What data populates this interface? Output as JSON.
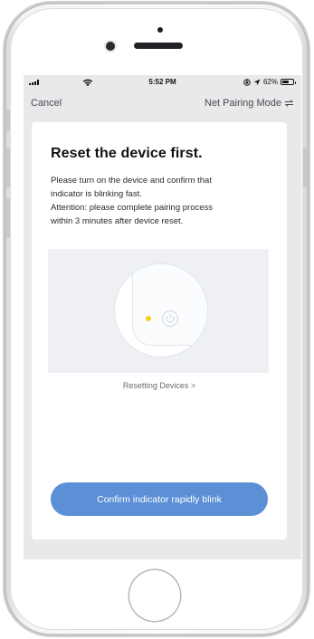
{
  "status_bar": {
    "time": "5:52 PM",
    "battery_percent": "62%",
    "battery_level": 0.62
  },
  "nav": {
    "cancel_label": "Cancel",
    "mode_label": "Net Pairing Mode"
  },
  "card": {
    "title": "Reset the device first.",
    "description_lines": [
      "Please turn on the device and confirm that",
      "indicator is blinking fast.",
      "Attention: please complete pairing process",
      "within 3 minutes after device reset."
    ],
    "reset_link_label": "Resetting Devices >"
  },
  "confirm_button_label": "Confirm indicator rapidly blink",
  "colors": {
    "accent": "#5b8fd6",
    "indicator_led": "#f6d21e",
    "screen_background": "#e9e9ec"
  },
  "icons": {
    "signal": "signal-icon",
    "wifi": "wifi-icon",
    "lock": "rotation-lock-icon",
    "location": "location-arrow-icon",
    "battery": "battery-icon",
    "switch": "switch-arrows-icon",
    "power": "power-icon"
  }
}
